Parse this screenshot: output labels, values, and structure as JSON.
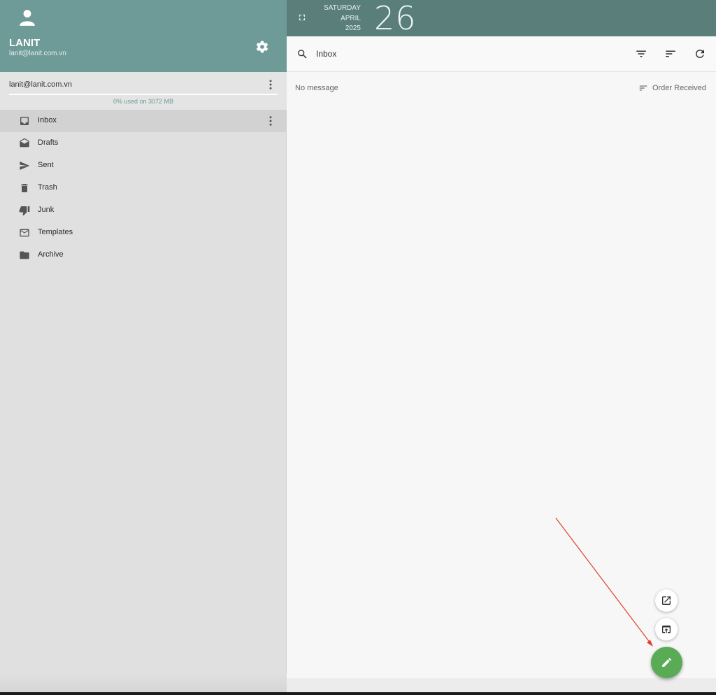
{
  "profile": {
    "name": "LANIT",
    "email": "lanit@lanit.com.vn",
    "avatar_icon": "person-icon",
    "settings_icon": "gear-icon"
  },
  "account": {
    "email": "lanit@lanit.com.vn",
    "usage_text": "0% used on 3072 MB",
    "usage_fraction": 0.0
  },
  "folders": [
    {
      "label": "Inbox",
      "icon": "inbox-icon",
      "active": true
    },
    {
      "label": "Drafts",
      "icon": "drafts-icon"
    },
    {
      "label": "Sent",
      "icon": "send-icon"
    },
    {
      "label": "Trash",
      "icon": "trash-icon"
    },
    {
      "label": "Junk",
      "icon": "thumb-down-icon"
    },
    {
      "label": "Templates",
      "icon": "envelope-icon"
    },
    {
      "label": "Archive",
      "icon": "folder-icon"
    }
  ],
  "date": {
    "weekday": "SATURDAY",
    "month": "APRIL",
    "year": "2025",
    "day": "26"
  },
  "toolbar": {
    "folder_title": "Inbox",
    "icons": [
      "search-icon",
      "filter-icon",
      "sort-icon",
      "refresh-icon"
    ]
  },
  "list": {
    "empty_text": "No message",
    "order_label": "Order Received"
  },
  "fabs": [
    "open-external-icon",
    "open-in-window-icon",
    "compose-pencil-icon"
  ],
  "colors": {
    "header_teal": "#6e9b97",
    "datebar_teal": "#5a7f7b",
    "compose_green": "#5aab55",
    "annotation_arrow": "#e0402a"
  }
}
